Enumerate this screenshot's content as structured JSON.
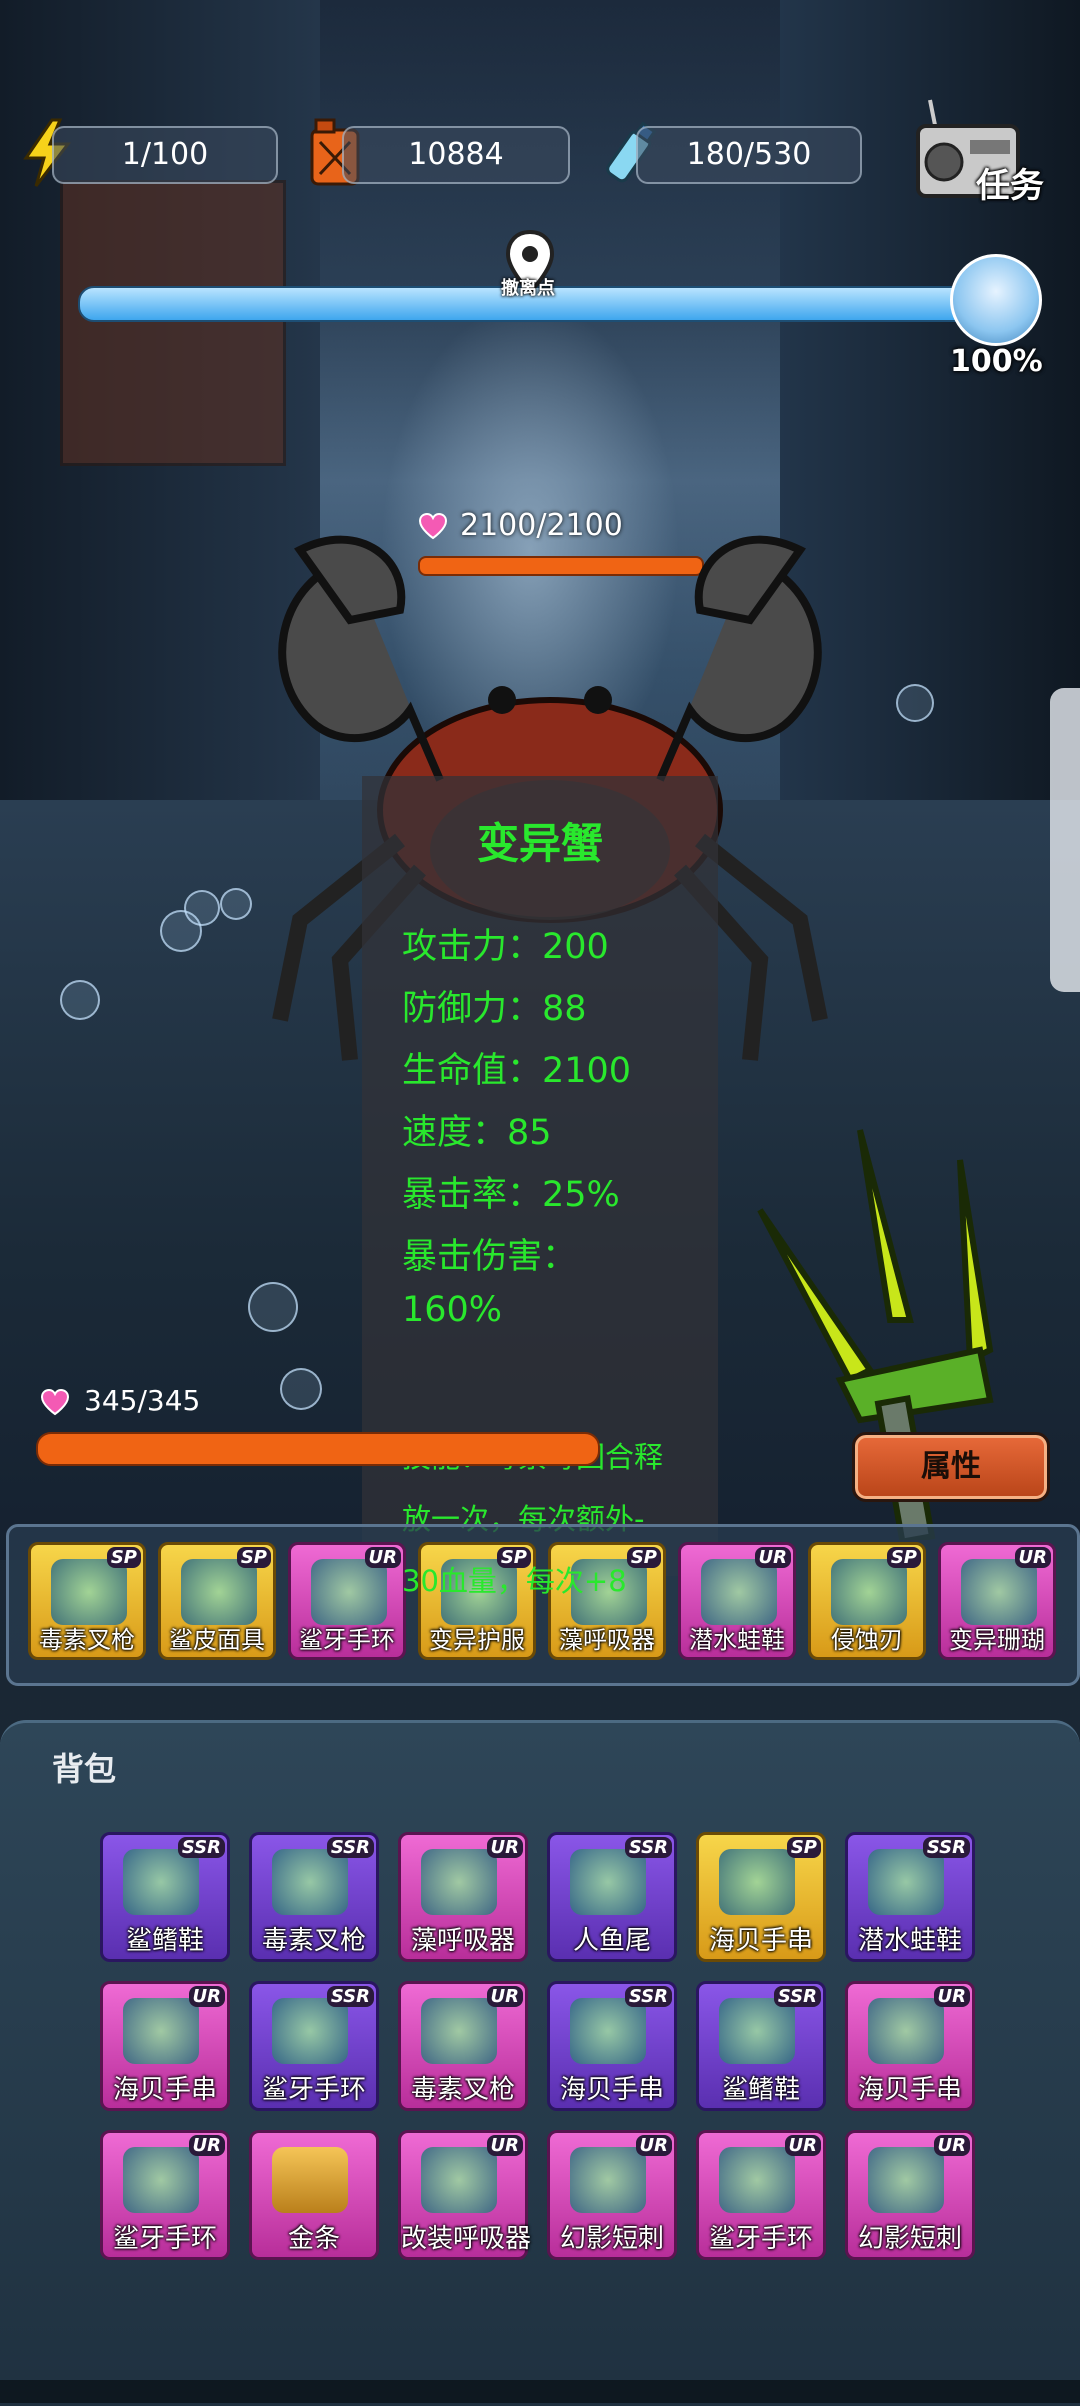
{
  "resources": {
    "energy": "1/100",
    "fuel": "10884",
    "water": "180/530"
  },
  "task_label": "任务",
  "progress": {
    "pin_label": "撤离点",
    "percent": "100%",
    "fill": 1.0
  },
  "enemy": {
    "hp": "2100/2100",
    "name": "变异蟹",
    "stats": [
      "攻击力：200",
      "防御力：88",
      "生命值：2100",
      "速度：85",
      "暴击率：25%",
      "暴击伤害：",
      "160%"
    ],
    "skill_lines": [
      "技能：毒素每回合释",
      "放一次，每次额外-",
      "30血量，每次+8"
    ]
  },
  "player": {
    "hp": "345/345"
  },
  "attr_button": "属性",
  "equipped": [
    {
      "name": "毒素叉枪",
      "rarity": "SP"
    },
    {
      "name": "鲨皮面具",
      "rarity": "SP"
    },
    {
      "name": "鲨牙手环",
      "rarity": "UR"
    },
    {
      "name": "变异护服",
      "rarity": "SP"
    },
    {
      "name": "藻呼吸器",
      "rarity": "SP"
    },
    {
      "name": "潜水蛙鞋",
      "rarity": "UR"
    },
    {
      "name": "侵蚀刃",
      "rarity": "SP"
    },
    {
      "name": "变异珊瑚",
      "rarity": "UR"
    }
  ],
  "bag": {
    "title": "背包",
    "items": [
      {
        "name": "鲨鳍鞋",
        "rarity": "SSR"
      },
      {
        "name": "毒素叉枪",
        "rarity": "SSR"
      },
      {
        "name": "藻呼吸器",
        "rarity": "UR"
      },
      {
        "name": "人鱼尾",
        "rarity": "SSR"
      },
      {
        "name": "海贝手串",
        "rarity": "SP"
      },
      {
        "name": "潜水蛙鞋",
        "rarity": "SSR"
      },
      {
        "name": "海贝手串",
        "rarity": "UR"
      },
      {
        "name": "鲨牙手环",
        "rarity": "SSR"
      },
      {
        "name": "毒素叉枪",
        "rarity": "UR"
      },
      {
        "name": "海贝手串",
        "rarity": "SSR"
      },
      {
        "name": "鲨鳍鞋",
        "rarity": "SSR"
      },
      {
        "name": "海贝手串",
        "rarity": "UR"
      },
      {
        "name": "鲨牙手环",
        "rarity": "UR"
      },
      {
        "name": "金条",
        "rarity": ""
      },
      {
        "name": "改装呼吸器",
        "rarity": "UR"
      },
      {
        "name": "幻影短刺",
        "rarity": "UR"
      },
      {
        "name": "鲨牙手环",
        "rarity": "UR"
      },
      {
        "name": "幻影短刺",
        "rarity": "UR"
      }
    ]
  },
  "colors": {
    "stat_green": "#29e82d",
    "hp_bar": "#f06414",
    "progress_blue": "#3ea6ee"
  }
}
